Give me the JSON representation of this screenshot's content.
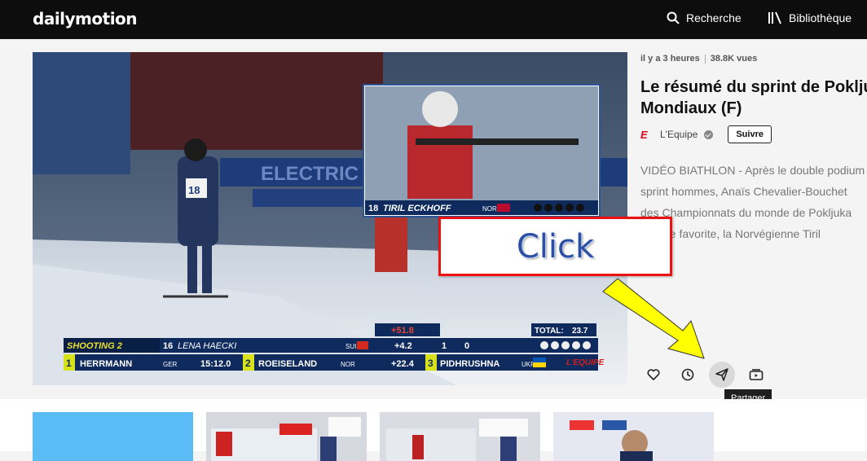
{
  "header": {
    "logo": "dailymotion",
    "search_label": "Recherche",
    "library_label": "Bibliothèque"
  },
  "video": {
    "time_ago": "il y a 3 heures",
    "views": "38.8K vues",
    "title_line1": "Le résumé du sprint de Pokljuka",
    "title_line2": "Mondiaux (F)",
    "channel_logo": "E",
    "channel_name": "L'Equipe",
    "follow_label": "Suivre",
    "description_lines": [
      "VIDÉO BIATHLON - Après le double podium",
      "sprint hommes, Anaïs Chevalier-Bouchet",
      "des Championnats du monde de Pokljuka",
      "grande favorite, la Norvégienne Tiril"
    ]
  },
  "player": {
    "sponsor_banner": "ELECTRIC",
    "bib_athlete": "18",
    "inset_name": "TIRIL ECKHOFF",
    "inset_nation": "NOR",
    "bib_left": "18",
    "score_stage": "SHOOTING 2",
    "score_current_bib": "16",
    "score_current_name": "LENA HAECKI",
    "score_current_nation": "SUI",
    "score_current_gap": "+4.2",
    "score_current_shots": "1",
    "score_current_miss": "0",
    "score_delta": "+51.8",
    "total_label": "TOTAL:",
    "total_value": "23.7",
    "ranking": [
      {
        "pos": "1",
        "name": "HERRMANN",
        "nation": "GER",
        "time": "15:12.0"
      },
      {
        "pos": "2",
        "name": "ROEISELAND",
        "nation": "NOR",
        "time": "+22.4"
      },
      {
        "pos": "3",
        "name": "PIDHRUSHNA",
        "nation": "UKR",
        "time": ""
      }
    ],
    "watermark": "L'EQUIPE"
  },
  "actions": {
    "like": "heart-icon",
    "watch_later": "clock-icon",
    "share": "send-icon",
    "add_playlist": "playlist-icon",
    "share_tooltip": "Partager"
  },
  "annotation": {
    "click_label": "Click",
    "arrow_color": "#ffff00",
    "box_border_color": "#ee1111"
  },
  "colors": {
    "header_bg": "#0d0d0d",
    "accent_red": "#e2001a",
    "score_yellow": "#d8e21a"
  }
}
